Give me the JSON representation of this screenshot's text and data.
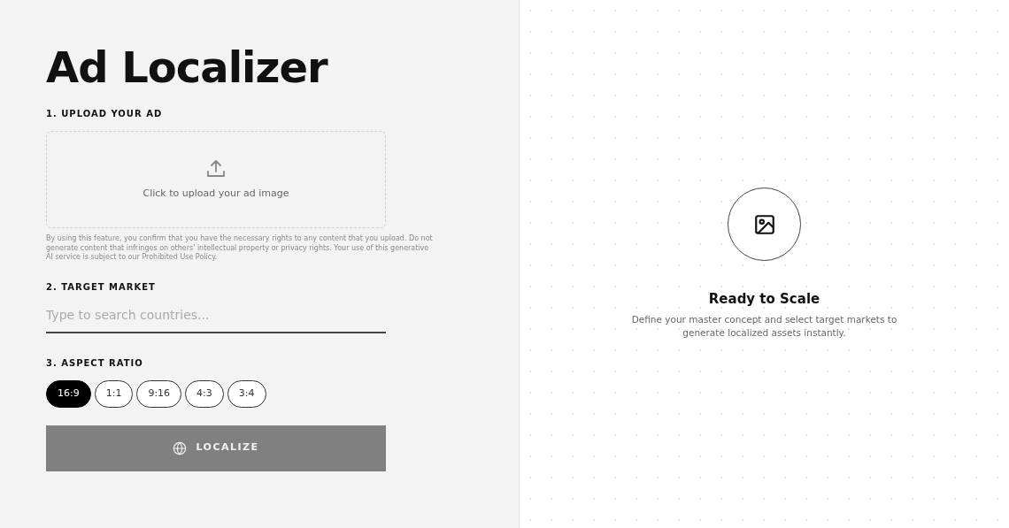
{
  "title": "Ad Localizer",
  "upload": {
    "label": "1. UPLOAD YOUR AD",
    "prompt": "Click to upload your ad image",
    "disclaimer": "By using this feature, you confirm that you have the necessary rights to any content that you upload. Do not generate content that infringes on others' intellectual property or privacy rights. Your use of this generative AI service is subject to our Prohibited Use Policy."
  },
  "market": {
    "label": "2. TARGET MARKET",
    "placeholder": "Type to search countries..."
  },
  "aspect": {
    "label": "3. ASPECT RATIO",
    "options": [
      {
        "label": "16:9",
        "selected": true
      },
      {
        "label": "1:1",
        "selected": false
      },
      {
        "label": "9:16",
        "selected": false
      },
      {
        "label": "4:3",
        "selected": false
      },
      {
        "label": "3:4",
        "selected": false
      }
    ]
  },
  "action": {
    "label": "LOCALIZE",
    "disabled": true
  },
  "preview": {
    "title": "Ready to Scale",
    "text": "Define your master concept and select target markets to generate localized assets instantly."
  }
}
